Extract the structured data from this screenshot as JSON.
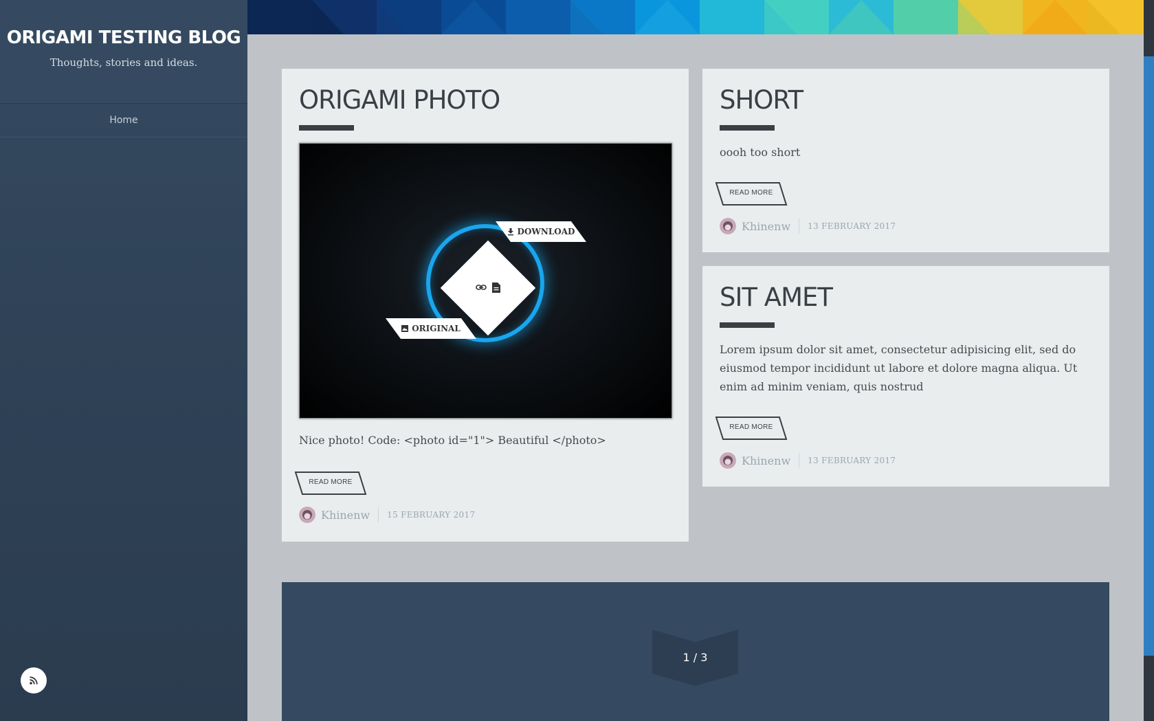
{
  "blog": {
    "title": "ORIGAMI TESTING BLOG",
    "tagline": "Thoughts, stories and ideas."
  },
  "nav": {
    "items": [
      {
        "label": "Home"
      }
    ]
  },
  "sidebar": {
    "rss_icon": "rss-icon"
  },
  "posts": [
    {
      "title": "ORIGAMI PHOTO",
      "excerpt": "Nice photo! Code: <photo id=\"1\"> Beautiful </photo>",
      "read_more": "READ MORE",
      "author": "Khinenw",
      "date": "15 FEBRUARY 2017",
      "photo": {
        "download_label": "DOWNLOAD",
        "original_label": "ORIGINAL",
        "center_icons": [
          "link-icon",
          "document-icon"
        ],
        "download_icon": "download-icon",
        "original_icon": "image-icon"
      }
    },
    {
      "title": "SHORT",
      "excerpt": "oooh too short",
      "read_more": "READ MORE",
      "author": "Khinenw",
      "date": "13 FEBRUARY 2017"
    },
    {
      "title": "SIT AMET",
      "excerpt": "Lorem ipsum dolor sit amet, consectetur adipisicing elit, sed do eiusmod tempor incididunt ut labore et dolore magna aliqua. Ut enim ad minim veniam, quis nostrud",
      "read_more": "READ MORE",
      "author": "Khinenw",
      "date": "13 FEBRUARY 2017"
    }
  ],
  "pagination": {
    "label": "1 / 3"
  },
  "colors": {
    "sidebar": "#354a60",
    "page_background": "#bfc3c7",
    "card": "#eaedee",
    "accent_ring": "#19a6ee",
    "scrollbar_thumb": "#2f7fc2"
  }
}
